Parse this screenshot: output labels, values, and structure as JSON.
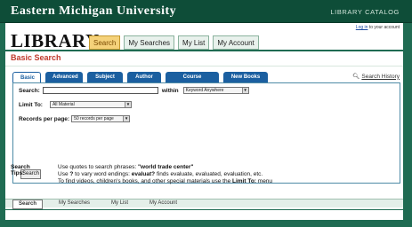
{
  "header": {
    "university": "Eastern Michigan University",
    "catalog": "LIBRARY CATALOG"
  },
  "logo": "LIBRARY",
  "login": {
    "link": "Log in",
    "suffix": " to your account"
  },
  "main_tabs": [
    "Search",
    "My Searches",
    "My List",
    "My Account"
  ],
  "page_title": "Basic Search",
  "sub_tabs": [
    "Basic",
    "Advanced",
    "Subject",
    "Author",
    "Course Reserve",
    "New Books"
  ],
  "search_history": "Search History",
  "form": {
    "search_label": "Search:",
    "search_value": "",
    "within_label": "within",
    "within_value": "Keyword Anywhere",
    "limit_label": "Limit To:",
    "limit_value": "All Material",
    "records_label": "Records per page:",
    "records_value": "50 records per page",
    "search_button": "Search"
  },
  "tips": {
    "label": "Search Tips:",
    "line1_a": "Use quotes to search phrases: ",
    "line1_b": "\"world trade center\"",
    "line2_a": "Use ",
    "line2_b": "?",
    "line2_c": " to vary word endings: ",
    "line2_d": "evaluat?",
    "line2_e": " finds evaluate, evaluated, evaluation, etc.",
    "line3_a": "To find videos, children's books, and other special materials use the ",
    "line3_b": "Limit To:",
    "line3_c": " menu"
  },
  "footer_tabs": [
    "Search",
    "My Searches",
    "My List",
    "My Account"
  ],
  "colors": {
    "brand_green": "#1f6b52",
    "tab_blue": "#1b5fa0",
    "title_red": "#c0392b",
    "active_tab": "#f5d27a"
  },
  "icons": {
    "history": "history-icon"
  }
}
